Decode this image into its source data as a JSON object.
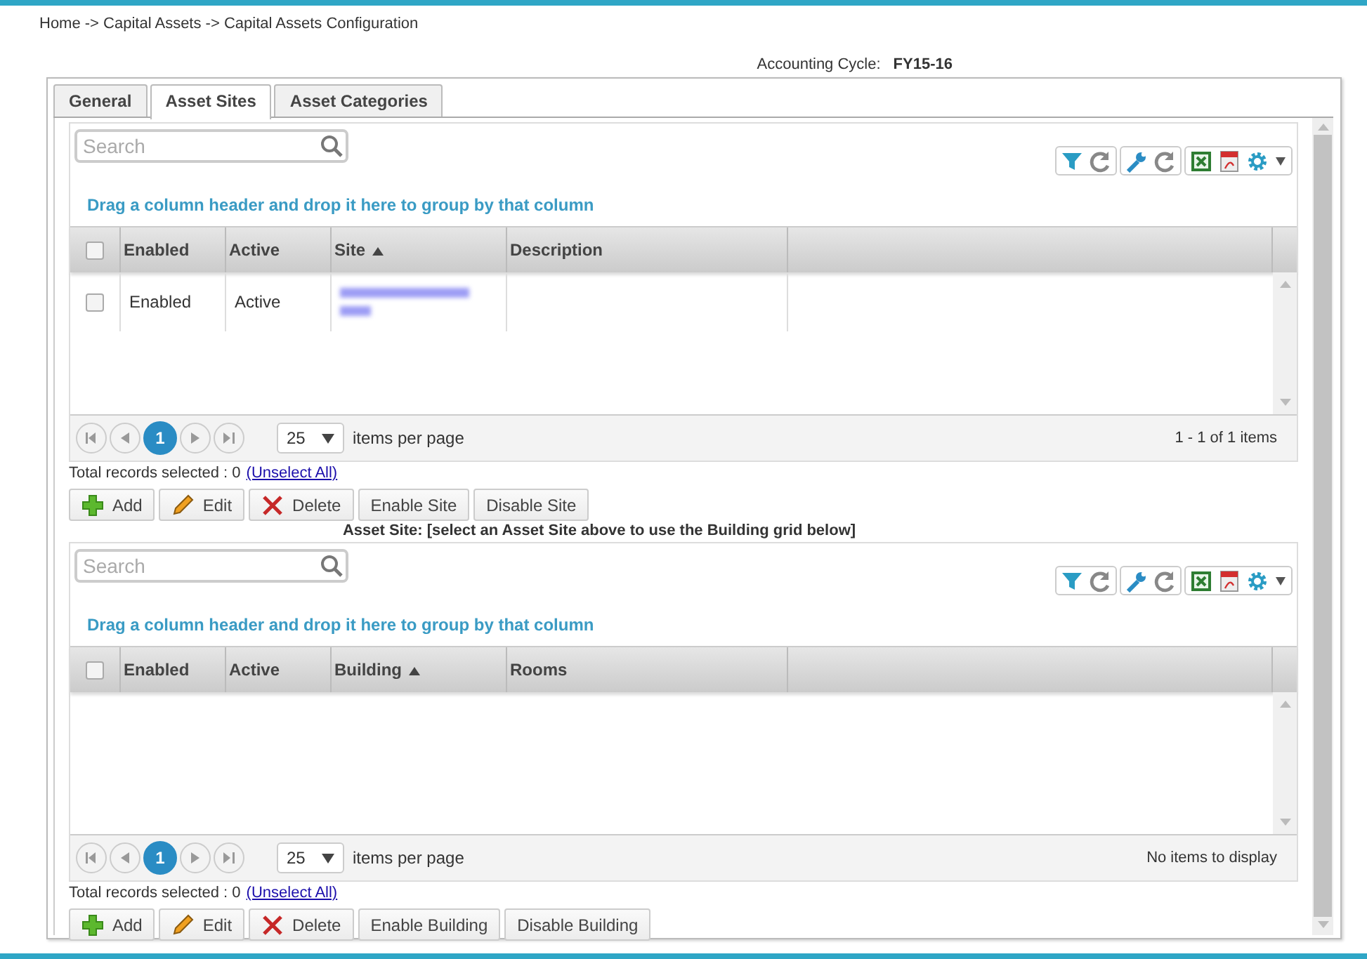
{
  "breadcrumb": "Home -> Capital Assets -> Capital Assets Configuration",
  "accounting_cycle": {
    "label": "Accounting Cycle:",
    "value": "FY15-16"
  },
  "tabs": [
    {
      "label": "General",
      "selected": false
    },
    {
      "label": "Asset Sites",
      "selected": true
    },
    {
      "label": "Asset Categories",
      "selected": false
    }
  ],
  "grids": [
    {
      "search": {
        "placeholder": "Search"
      },
      "group_hint": "Drag a column header and drop it here to group by that column",
      "header_checked": false,
      "columns": [
        {
          "label": "Enabled",
          "sorted": false
        },
        {
          "label": "Active",
          "sorted": false
        },
        {
          "label": "Site",
          "sorted": true
        },
        {
          "label": "Description",
          "sorted": false
        }
      ],
      "rows": [
        {
          "checked": false,
          "cells": [
            {
              "kind": "text",
              "text": "Enabled"
            },
            {
              "kind": "text",
              "text": "Active"
            },
            {
              "kind": "blurred"
            },
            {
              "kind": "empty"
            }
          ]
        }
      ],
      "pager": {
        "pages": [
          {
            "label": "1",
            "selected": true
          }
        ],
        "page_size": "25",
        "per_page_label": "items per page",
        "info": "1 - 1 of 1 items"
      },
      "total_label": "Total records selected : 0",
      "unselect": "(Unselect All)",
      "buttons": [
        {
          "kind": "add",
          "label": "Add"
        },
        {
          "kind": "edit",
          "label": "Edit"
        },
        {
          "kind": "delete",
          "label": "Delete"
        },
        {
          "kind": "plain",
          "label": "Enable Site"
        },
        {
          "kind": "plain",
          "label": "Disable Site"
        }
      ]
    },
    {
      "caption": "Asset Site: [select an Asset Site above to use the Building grid below]",
      "search": {
        "placeholder": "Search"
      },
      "group_hint": "Drag a column header and drop it here to group by that column",
      "header_checked": false,
      "columns": [
        {
          "label": "Enabled",
          "sorted": false
        },
        {
          "label": "Active",
          "sorted": false
        },
        {
          "label": "Building",
          "sorted": true
        },
        {
          "label": "Rooms",
          "sorted": false
        }
      ],
      "pager": {
        "pages": [
          {
            "label": "1",
            "selected": true
          }
        ],
        "page_size": "25",
        "per_page_label": "items per page",
        "info": "No items to display"
      },
      "total_label": "Total records selected : 0",
      "unselect": "(Unselect All)",
      "buttons": [
        {
          "kind": "add",
          "label": "Add"
        },
        {
          "kind": "edit",
          "label": "Edit"
        },
        {
          "kind": "delete",
          "label": "Delete"
        },
        {
          "kind": "plain",
          "label": "Enable Building"
        },
        {
          "kind": "plain",
          "label": "Disable Building"
        }
      ]
    }
  ]
}
